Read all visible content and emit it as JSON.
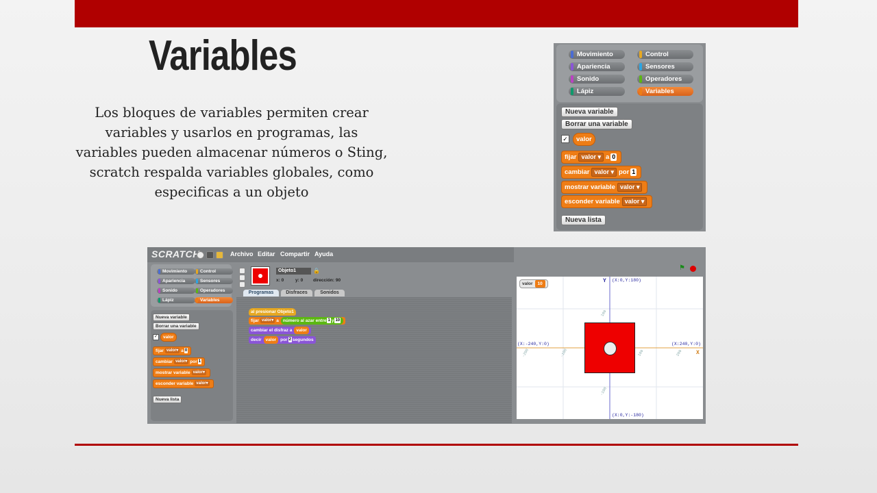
{
  "slide": {
    "title": "Variables",
    "description": "Los bloques de variables permiten crear variables y usarlos en programas, las variables pueden almacenar números o Sting, scratch respalda variables globales, como especificas a un objeto",
    "accent": "#b00000"
  },
  "palette": {
    "categories": [
      {
        "label": "Movimiento",
        "color": "#4a6cd4"
      },
      {
        "label": "Control",
        "color": "#e6a822"
      },
      {
        "label": "Apariencia",
        "color": "#8a55d7"
      },
      {
        "label": "Sensores",
        "color": "#2ca5e2"
      },
      {
        "label": "Sonido",
        "color": "#bb42c3"
      },
      {
        "label": "Operadores",
        "color": "#5cb712"
      },
      {
        "label": "Lápiz",
        "color": "#0e9a6c"
      },
      {
        "label": "Variables",
        "color": "#ee7d16"
      }
    ],
    "new_variable": "Nueva variable",
    "delete_variable": "Borrar una variable",
    "variable_name": "valor",
    "set_block": {
      "label": "fijar",
      "var": "valor",
      "to": "a",
      "value": "0"
    },
    "change_block": {
      "label": "cambiar",
      "var": "valor",
      "by": "por",
      "value": "1"
    },
    "show_block": {
      "label": "mostrar variable",
      "var": "valor"
    },
    "hide_block": {
      "label": "esconder variable",
      "var": "valor"
    },
    "new_list": "Nueva lista"
  },
  "scratch": {
    "logo": "SCRATCH",
    "menu": [
      "Archivo",
      "Editar",
      "Compartir",
      "Ayuda"
    ],
    "sprite_name": "Objeto1",
    "x_label": "x: 0",
    "y_label": "y: 0",
    "direction_label": "dirección: 90",
    "tabs": [
      "Programas",
      "Disfraces",
      "Sonidos"
    ],
    "script": {
      "hat": "al presionar Objeto1",
      "set": {
        "label": "fijar",
        "var": "valor",
        "to": "a",
        "random": "número al azar entre",
        "from": "1",
        "and": "y",
        "to_val": "10"
      },
      "costume": {
        "label": "cambiar el disfraz a",
        "var": "valor"
      },
      "say": {
        "label": "decir",
        "var": "valor",
        "for": "por",
        "secs": "2",
        "unit": "segundos"
      }
    },
    "monitor": {
      "name": "valor",
      "value": "10"
    },
    "stage_labels": {
      "top": "(X:0,Y:180)",
      "bottom": "(X:0,Y:-180)",
      "left": "(X:-240,Y:0)",
      "right": "(X:240,Y:0)",
      "x_axis": "X",
      "y_axis": "Y",
      "ticks_x": [
        "-200",
        "-100",
        "100",
        "200"
      ],
      "ticks_y": [
        "100",
        "-100"
      ]
    }
  }
}
